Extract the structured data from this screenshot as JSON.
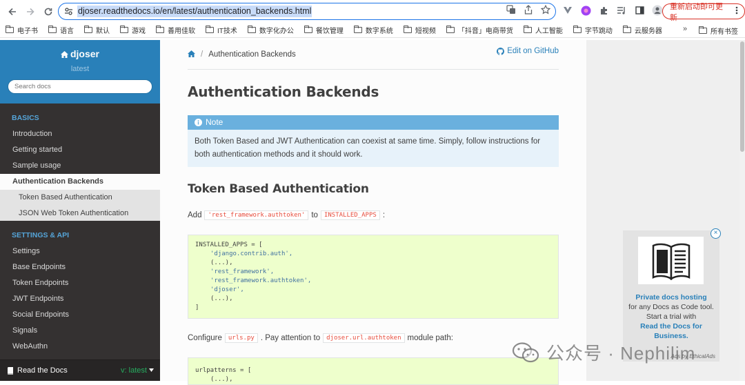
{
  "browser": {
    "url": "djoser.readthedocs.io/en/latest/authentication_backends.html",
    "restart_label": "重新启动即可更新",
    "bookmarks": [
      {
        "label": "电子书"
      },
      {
        "label": "语言"
      },
      {
        "label": "默认"
      },
      {
        "label": "游戏"
      },
      {
        "label": "善用佳软"
      },
      {
        "label": "IT技术"
      },
      {
        "label": "数字化办公"
      },
      {
        "label": "餐饮管理"
      },
      {
        "label": "数字系统"
      },
      {
        "label": "短视频"
      },
      {
        "label": "「抖音」电商带货"
      },
      {
        "label": "人工智能"
      },
      {
        "label": "字节跳动"
      },
      {
        "label": "云服务器"
      }
    ],
    "more_label": "»",
    "all_bookmarks_label": "所有书签"
  },
  "sidebar": {
    "project": "djoser",
    "version": "latest",
    "search_placeholder": "Search docs",
    "caption_basics": "BASICS",
    "basics": [
      {
        "label": "Introduction"
      },
      {
        "label": "Getting started"
      },
      {
        "label": "Sample usage"
      }
    ],
    "current": "Authentication Backends",
    "subitems": [
      {
        "label": "Token Based Authentication"
      },
      {
        "label": "JSON Web Token Authentication"
      }
    ],
    "caption_settings": "SETTINGS & API",
    "settings": [
      {
        "label": "Settings"
      },
      {
        "label": "Base Endpoints"
      },
      {
        "label": "Token Endpoints"
      },
      {
        "label": "JWT Endpoints"
      },
      {
        "label": "Social Endpoints"
      },
      {
        "label": "Signals"
      },
      {
        "label": "WebAuthn"
      }
    ],
    "footer_label": "Read the Docs",
    "footer_version": "v: latest"
  },
  "content": {
    "breadcrumb_current": "Authentication Backends",
    "breadcrumb_sep": "/",
    "edit_link": "Edit on GitHub",
    "title": "Authentication Backends",
    "note_title": "Note",
    "note_body": "Both Token Based and JWT Authentication can coexist at same time. Simply, follow instructions for both authentication methods and it should work.",
    "h2": "Token Based Authentication",
    "p1_before": "Add",
    "p1_code1": "'rest_framework.authtoken'",
    "p1_mid": "to",
    "p1_code2": "INSTALLED_APPS",
    "p1_after": ":",
    "code1_open": "INSTALLED_APPS = [",
    "code1_items": [
      "'django.contrib.auth',",
      "(...),",
      "'rest_framework',",
      "'rest_framework.authtoken',",
      "'djoser',",
      "(...),"
    ],
    "code1_close": "]",
    "p2_before": "Configure",
    "p2_code1": "urls.py",
    "p2_mid": ". Pay attention to",
    "p2_code2": "djoser.url.authtoken",
    "p2_after": "module path:",
    "code2_open": "urlpatterns = [",
    "code2_next": "(...),"
  },
  "ad": {
    "link1": "Private docs hosting",
    "body": "for any Docs as Code tool. Start a trial with",
    "link2": "Read the Docs for Business.",
    "by": "Ads by EthicalAds",
    "close": "×"
  },
  "watermark": {
    "text": "公众号 · Nephilim"
  },
  "colors": {
    "sidebar_bg": "#343131",
    "sidebar_head": "#2980b9",
    "note_title_bg": "#6ab0de",
    "code_bg": "#eeffcc",
    "inline_code": "#e74c3c",
    "link": "#2980b9",
    "restart": "#d93025"
  }
}
